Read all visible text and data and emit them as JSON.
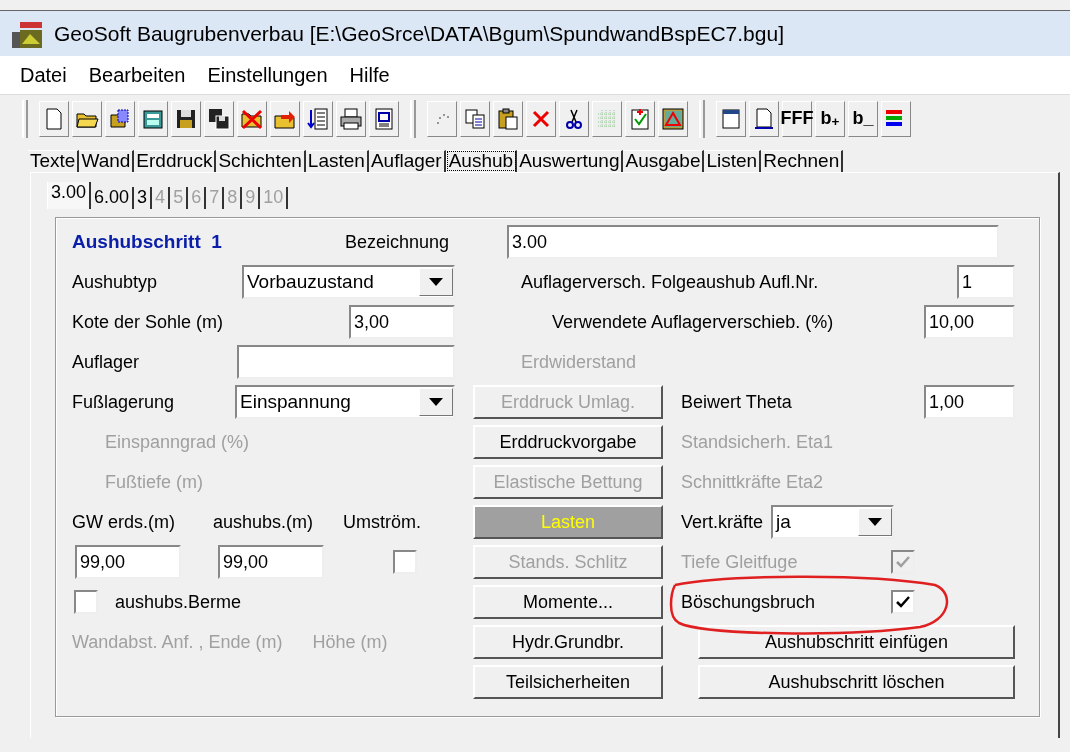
{
  "window": {
    "title": "GeoSoft Baugrubenverbau [E:\\GeoSrce\\DATA\\Bgum\\SpundwandBspEC7.bgu]"
  },
  "menu": [
    {
      "label": "Datei"
    },
    {
      "label": "Bearbeiten"
    },
    {
      "label": "Einstellungen"
    },
    {
      "label": "Hilfe"
    }
  ],
  "toolbar": {
    "text_buttons": [
      "FFF",
      "b$_{+}$",
      "b_"
    ]
  },
  "tabs": [
    {
      "label": "Texte",
      "selected": false
    },
    {
      "label": "Wand",
      "selected": false
    },
    {
      "label": "Erddruck",
      "selected": false
    },
    {
      "label": "Schichten",
      "selected": false
    },
    {
      "label": "Lasten",
      "selected": false
    },
    {
      "label": "Auflager",
      "selected": false
    },
    {
      "label": "Aushub",
      "selected": true
    },
    {
      "label": "Auswertung",
      "selected": false
    },
    {
      "label": "Ausgabe",
      "selected": false
    },
    {
      "label": "Listen",
      "selected": false
    },
    {
      "label": "Rechnen",
      "selected": false
    }
  ],
  "step_tabs": [
    {
      "label": "3.00",
      "selected": true,
      "disabled": false
    },
    {
      "label": "6.00",
      "selected": false,
      "disabled": false
    },
    {
      "label": "3",
      "selected": false,
      "disabled": false
    },
    {
      "label": "4",
      "selected": false,
      "disabled": true
    },
    {
      "label": "5",
      "selected": false,
      "disabled": true
    },
    {
      "label": "6",
      "selected": false,
      "disabled": true
    },
    {
      "label": "7",
      "selected": false,
      "disabled": true
    },
    {
      "label": "8",
      "selected": false,
      "disabled": true
    },
    {
      "label": "9",
      "selected": false,
      "disabled": true
    },
    {
      "label": "10",
      "selected": false,
      "disabled": true
    }
  ],
  "form": {
    "heading": "Aushubschritt  1",
    "bezeichnung": {
      "label": "Bezeichnung",
      "value": "3.00"
    },
    "aushubtyp": {
      "label": "Aushubtyp",
      "value": "Vorbauzustand"
    },
    "kote": {
      "label": "Kote der Sohle (m)",
      "value": "3,00"
    },
    "auflager": {
      "label": "Auflager"
    },
    "fusslagerung": {
      "label": "Fußlagerung",
      "value": "Einspannung"
    },
    "einspanngrad": {
      "label": "Einspanngrad (%)",
      "disabled": true
    },
    "fusstiefe": {
      "label": "Fußtiefe (m)",
      "disabled": true
    },
    "gw_erds": {
      "label": "GW erds.(m)",
      "value": "99,00"
    },
    "gw_aushubs": {
      "label": "aushubs.(m)",
      "value": "99,00"
    },
    "umstroem": {
      "label": "Umström.",
      "checked": false
    },
    "berme": {
      "label": "aushubs.Berme",
      "checked": false
    },
    "wandabst": {
      "label": "Wandabst. Anf. , Ende (m)",
      "disabled": true
    },
    "hoehe": {
      "label": "Höhe (m)",
      "disabled": true
    },
    "folgeaushub": {
      "label": "Auflagerversch. Folgeaushub Aufl.Nr.",
      "value": "1"
    },
    "verschiebung": {
      "label": "Verwendete Auflagerverschieb. (%)",
      "value": "10,00"
    },
    "erdwiderstand": {
      "label": "Erdwiderstand",
      "disabled": true
    },
    "theta": {
      "label": "Beiwert Theta",
      "value": "1,00"
    },
    "eta1": {
      "label": "Standsicherh. Eta1",
      "disabled": true
    },
    "eta2": {
      "label": "Schnittkräfte Eta2",
      "disabled": true
    },
    "vertkraefte": {
      "label": "Vert.kräfte",
      "value": "ja"
    },
    "gleitfuge": {
      "label": "Tiefe Gleitfuge",
      "checked": true,
      "disabled": true
    },
    "boeschung": {
      "label": "Böschungsbruch",
      "checked": true,
      "circled": true
    },
    "middle_buttons": [
      {
        "label": "Erddruck Umlag.",
        "disabled": true,
        "highlighted": false
      },
      {
        "label": "Erddruckvorgabe",
        "disabled": false,
        "highlighted": false
      },
      {
        "label": "Elastische Bettung",
        "disabled": true,
        "highlighted": false
      },
      {
        "label": "Lasten",
        "disabled": false,
        "highlighted": true
      },
      {
        "label": "Stands. Schlitz",
        "disabled": true,
        "highlighted": false
      },
      {
        "label": "Momente...",
        "disabled": false,
        "highlighted": false
      },
      {
        "label": "Hydr.Grundbr.",
        "disabled": false,
        "highlighted": false
      },
      {
        "label": "Teilsicherheiten",
        "disabled": false,
        "highlighted": false
      }
    ],
    "step_buttons": [
      {
        "label": "Aushubschritt einfügen"
      },
      {
        "label": "Aushubschritt löschen"
      }
    ]
  }
}
